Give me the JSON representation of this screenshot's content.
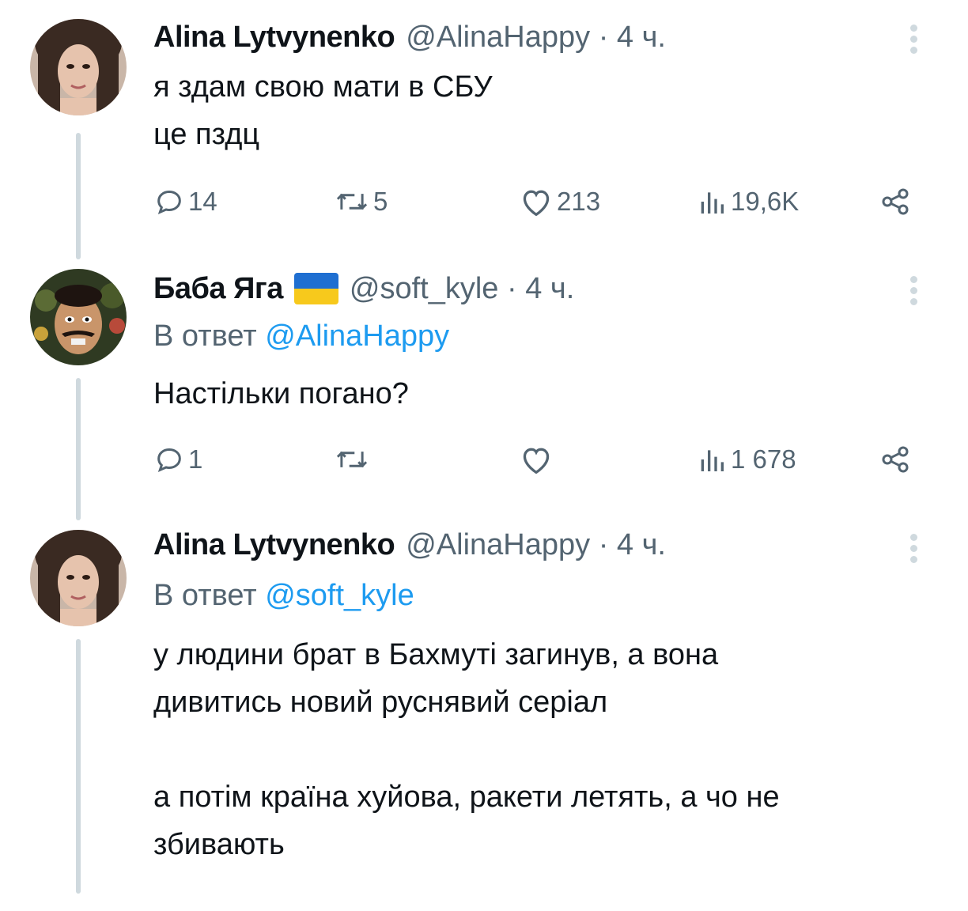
{
  "colors": {
    "text": "#0f1419",
    "secondary": "#536471",
    "link": "#1d9bf0",
    "thread_line": "#cfd9de"
  },
  "tweets": [
    {
      "name": "Alina Lytvynenko",
      "handle": "@AlinaHappy",
      "time": "· 4 ч.",
      "text": "я здам свою мати в СБУ\nце пздц",
      "stats": {
        "replies": "14",
        "retweets": "5",
        "likes": "213",
        "views": "19,6K"
      }
    },
    {
      "name": "Баба Яга",
      "flag": "ukraine-flag-icon",
      "handle": "@soft_kyle",
      "time": "· 4 ч.",
      "reply_prefix": "В ответ",
      "reply_handle": "@AlinaHappy",
      "text": "Настільки погано?",
      "stats": {
        "replies": "1",
        "retweets": "",
        "likes": "",
        "views": "1 678"
      }
    },
    {
      "name": "Alina Lytvynenko",
      "handle": "@AlinaHappy",
      "time": "· 4 ч.",
      "reply_prefix": "В ответ",
      "reply_handle": "@soft_kyle",
      "text": "у людини брат в Бахмуті загинув, а вона\nдивитись новий руснявий серіал\n\nа потім країна хуйова, ракети летять, а чо не\nзбивають"
    }
  ]
}
